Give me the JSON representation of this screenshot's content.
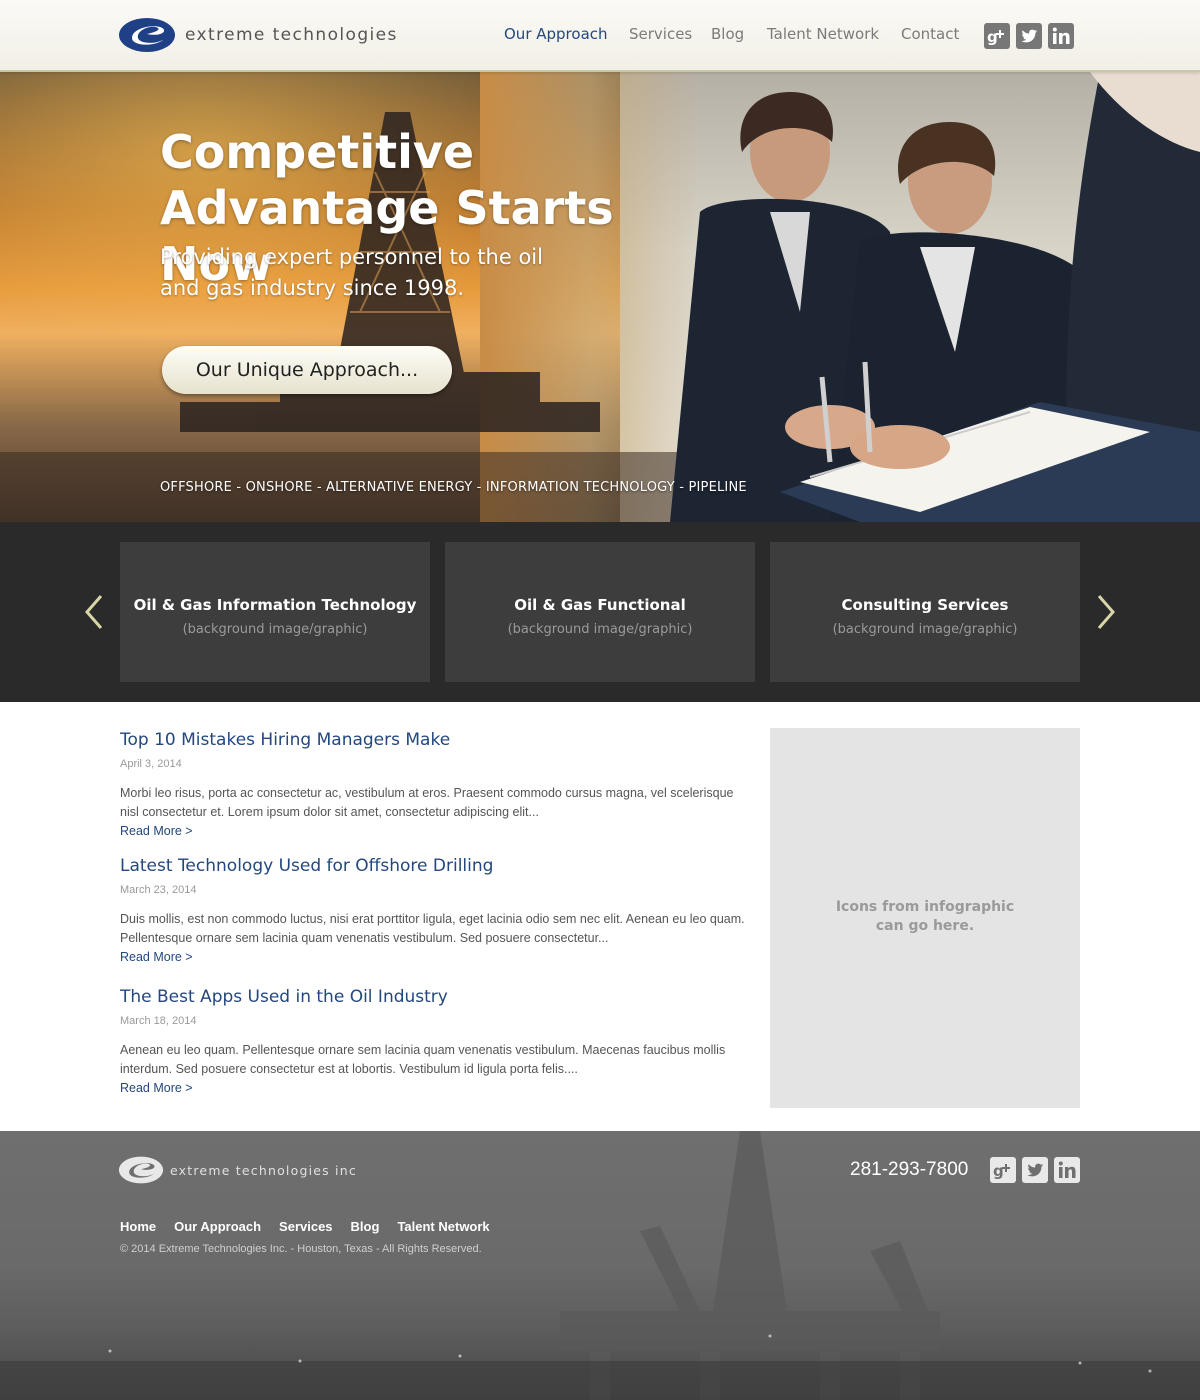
{
  "header": {
    "logo_text": "extreme technologies",
    "nav": [
      {
        "label": "Our Approach",
        "active": true
      },
      {
        "label": "Services",
        "active": false
      },
      {
        "label": "Blog",
        "active": false
      },
      {
        "label": "Talent Network",
        "active": false
      },
      {
        "label": "Contact",
        "active": false
      }
    ],
    "social": [
      "google-plus-icon",
      "twitter-icon",
      "linkedin-icon"
    ]
  },
  "hero": {
    "title": "Competitive Advantage Starts Now",
    "subtitle": "Providing expert personnel to the oil and gas industry since 1998.",
    "button_label": "Our Unique Approach...",
    "tags": "OFFSHORE - ONSHORE - ALTERNATIVE ENERGY - INFORMATION TECHNOLOGY - PIPELINE"
  },
  "carousel": {
    "cards": [
      {
        "title": "Oil & Gas Information Technology",
        "subtitle": "(background image/graphic)"
      },
      {
        "title": "Oil & Gas Functional",
        "subtitle": "(background image/graphic)"
      },
      {
        "title": "Consulting Services",
        "subtitle": "(background image/graphic)"
      }
    ],
    "prev_icon": "chevron-left-icon",
    "next_icon": "chevron-right-icon"
  },
  "posts": [
    {
      "title": "Top 10 Mistakes Hiring Managers Make",
      "date": "April 3, 2014",
      "excerpt": "Morbi leo risus, porta ac consectetur ac, vestibulum at eros. Praesent commodo cursus magna, vel scelerisque nisl consectetur et. Lorem ipsum dolor sit amet, consectetur adipiscing elit...",
      "read_more": "Read More >"
    },
    {
      "title": "Latest Technology Used for Offshore Drilling",
      "date": "March 23, 2014",
      "excerpt": "Duis mollis, est non commodo luctus, nisi erat porttitor ligula, eget lacinia odio sem nec elit. Aenean eu leo quam. Pellentesque ornare sem lacinia quam venenatis vestibulum. Sed posuere consectetur...",
      "read_more": "Read More >"
    },
    {
      "title": "The Best Apps Used in the Oil Industry",
      "date": "March 18, 2014",
      "excerpt": "Aenean eu leo quam. Pellentesque ornare sem lacinia quam venenatis vestibulum. Maecenas faucibus mollis interdum. Sed posuere consectetur est at lobortis. Vestibulum id ligula porta felis....",
      "read_more": "Read More >"
    }
  ],
  "infobox": {
    "text": "Icons from infographic\ncan go here."
  },
  "footer": {
    "logo_text": "extreme technologies inc",
    "phone": "281-293-7800",
    "nav": [
      "Home",
      "Our Approach",
      "Services",
      "Blog",
      "Talent Network"
    ],
    "copyright": "© 2014 Extreme Technologies Inc. - Houston, Texas - All Rights Reserved."
  },
  "colors": {
    "brand_blue": "#23477e",
    "nav_gray": "#7b7b7b",
    "carousel_bg": "#2a2a2a",
    "card_bg": "#3d3d3d",
    "accent_arrow": "#d8d6a6"
  }
}
